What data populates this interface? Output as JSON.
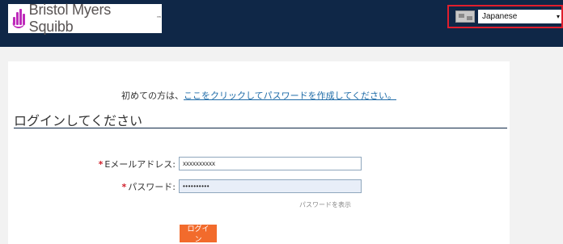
{
  "header": {
    "logo_text": "Bristol Myers Squibb",
    "logo_tm": "™",
    "language": {
      "flag_icon": "world-map-flag-icon",
      "selected": "Japanese",
      "caret": "▾"
    }
  },
  "main": {
    "first_time_prefix": "初めての方は、",
    "first_time_link": "ここをクリックしてパスワードを作成してください。",
    "login_title": "ログインしてください",
    "email": {
      "required_mark": "*",
      "label": "Eメールアドレス:",
      "value": "xxxxxxxxxx"
    },
    "password": {
      "required_mark": "*",
      "label": "パスワード:",
      "value": "••••••••••"
    },
    "show_password": "パスワードを表示",
    "login_button": "ログイン"
  },
  "colors": {
    "header_bg": "#0f2747",
    "accent_orange": "#f26b2c",
    "highlight_red": "#e01e2d",
    "link_blue": "#1f6ca8",
    "brand_purple": "#be2bbb"
  }
}
